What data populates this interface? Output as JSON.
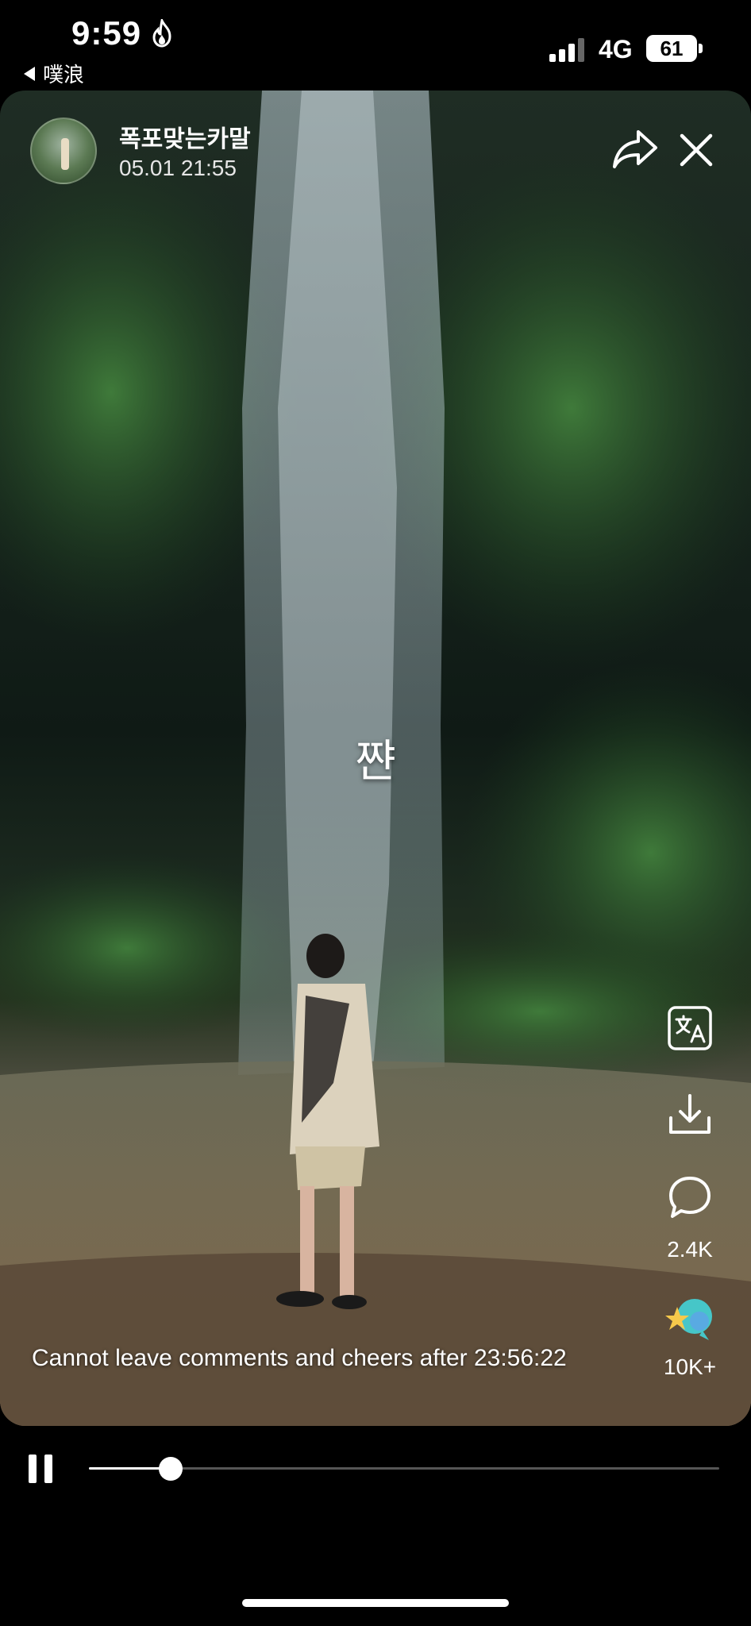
{
  "status_bar": {
    "time": "9:59",
    "back_app": "噗浪",
    "network": "4G",
    "battery": "61"
  },
  "post": {
    "author": "폭포맞는카말",
    "time": "05.01 21:55",
    "overlay_text": "쨘",
    "notice": "Cannot leave comments and cheers after 23:56:22"
  },
  "actions": {
    "comment_count": "2.4K",
    "cheer_count": "10K+",
    "icons": [
      "share-icon",
      "close-icon",
      "translate-icon",
      "download-icon",
      "comment-icon",
      "cheer-icon"
    ]
  },
  "player": {
    "progress": 0.13
  },
  "colors": {
    "background": "#000000",
    "text": "#ffffff",
    "cheer_star": "#f6c94b",
    "cheer_bubble": "#46c6c8"
  }
}
